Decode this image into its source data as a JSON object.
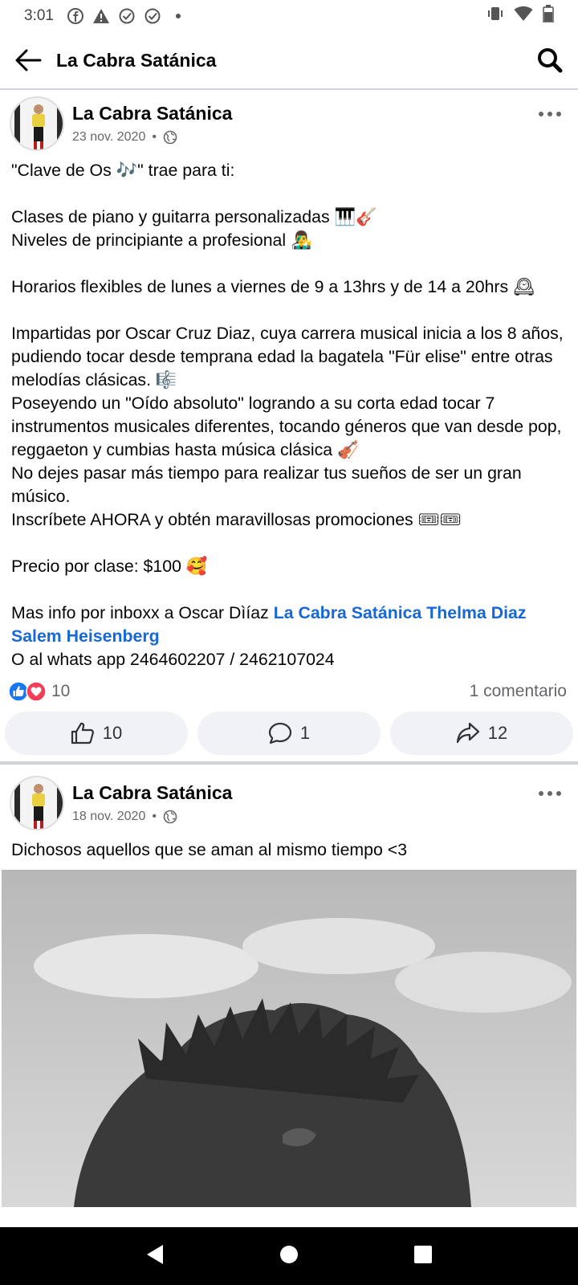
{
  "status": {
    "time": "3:01"
  },
  "header": {
    "title": "La Cabra Satánica"
  },
  "posts": [
    {
      "author": "La Cabra Satánica",
      "date": "23 nov. 2020",
      "text_part1": "\"Clave de Os 🎶\" trae para ti:\n\nClases de piano y guitarra personalizadas 🎹🎸\nNiveles de principiante a profesional 👨‍🎤\n\nHorarios flexibles de lunes a viernes de 9 a 13hrs y de 14 a 20hrs 🕰\n\nImpartidas por Oscar Cruz Diaz, cuya carrera musical inicia a los 8 años, pudiendo tocar desde temprana edad la bagatela \"Für elise\" entre otras melodías clásicas. 🎼\nPoseyendo un \"Oído absoluto\" logrando a su corta edad tocar 7 instrumentos musicales diferentes, tocando géneros que van desde pop, reggaeton y cumbias hasta música clásica 🎻\nNo dejes pasar más tiempo para realizar tus sueños de ser un gran músico.\nInscríbete AHORA y obtén maravillosas promociones 🎟🎟\n\nPrecio por clase: $100 🥰\n\nMas info por inboxx a Oscar Dìíaz ",
      "link_text": "La Cabra Satánica Thelma Diaz Salem Heisenberg",
      "text_part2": "\nO al whats app 2464602207 / 2462107024",
      "reaction_count": "10",
      "comments_text": "1 comentario",
      "like_count": "10",
      "comment_count": "1",
      "share_count": "12"
    },
    {
      "author": "La Cabra Satánica",
      "date": "18 nov. 2020",
      "text": "Dichosos aquellos que se aman al mismo tiempo <3"
    }
  ],
  "colors": {
    "link": "#1668d6",
    "like_blue": "#1877f2",
    "love_red": "#f33e58"
  }
}
